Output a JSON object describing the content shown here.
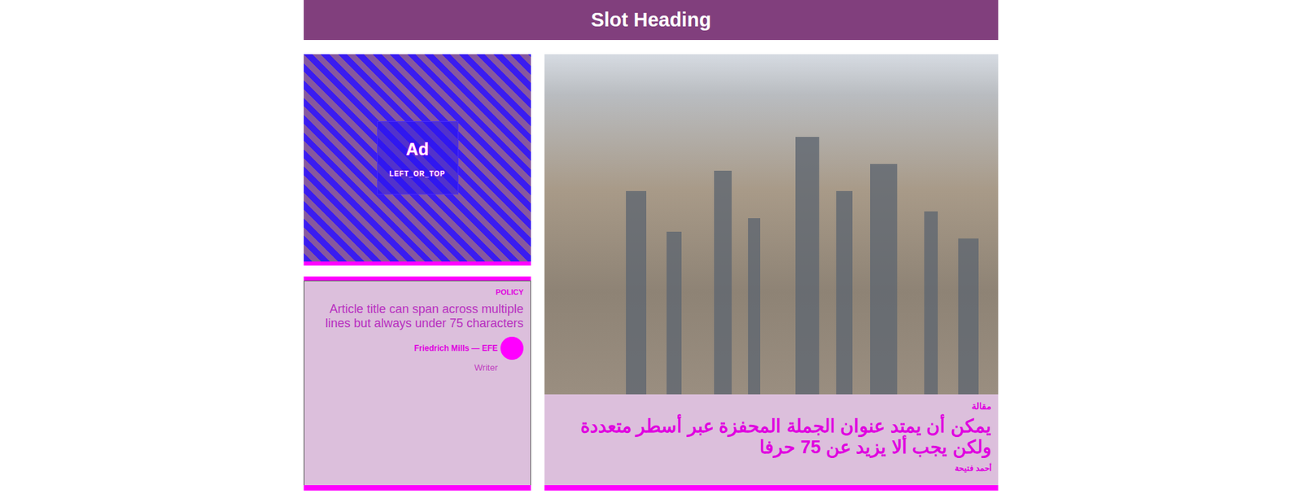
{
  "heading": "Slot Heading",
  "ad": {
    "label": "Ad",
    "slot": "LEFT_OR_TOP"
  },
  "article": {
    "kicker": "POLICY",
    "title": "Article title can span across multiple lines but always under 75 characters",
    "byline": "Friedrich Mills — EFE",
    "role": "Writer"
  },
  "feature": {
    "kicker": "مقالة",
    "title": "يمكن أن يمتد عنوان الجملة المحفزة عبر أسطر متعددة ولكن يجب ألا يزيد عن 75 حرفا",
    "author": "أحمد فتيحة"
  }
}
